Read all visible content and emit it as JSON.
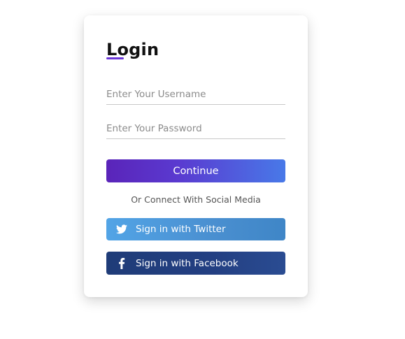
{
  "login": {
    "title": "Login",
    "username_placeholder": "Enter Your Username",
    "password_placeholder": "Enter Your Password",
    "continue_label": "Continue",
    "social_text": "Or Connect With Social Media",
    "twitter_label": "Sign in with Twitter",
    "facebook_label": "Sign in with Facebook"
  },
  "icons": {
    "twitter": "twitter-icon",
    "facebook": "facebook-icon"
  },
  "colors": {
    "accent": "#6a35d8",
    "continue_start": "#5a24b9",
    "continue_end": "#4879e8",
    "twitter": "#4a8fd0",
    "facebook": "#233f82"
  }
}
